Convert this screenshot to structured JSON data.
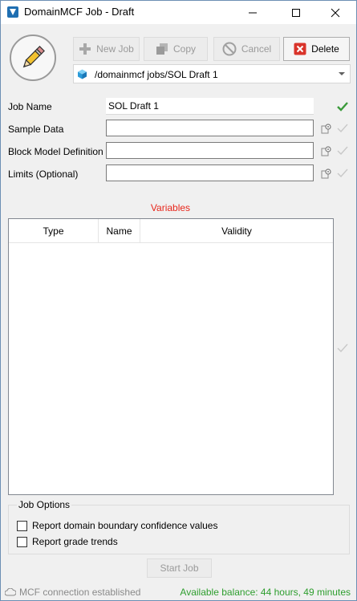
{
  "window": {
    "title": "DomainMCF Job - Draft"
  },
  "toolbar": {
    "new_job_label": "New Job",
    "copy_label": "Copy",
    "cancel_label": "Cancel",
    "delete_label": "Delete"
  },
  "path": {
    "value": "/domainmcf jobs/SOL Draft 1"
  },
  "form": {
    "job_name_label": "Job Name",
    "job_name_value": "SOL Draft 1",
    "sample_data_label": "Sample Data",
    "sample_data_value": "",
    "block_model_label": "Block Model Definition",
    "block_model_value": "",
    "limits_label": "Limits (Optional)",
    "limits_value": ""
  },
  "variables": {
    "title": "Variables",
    "columns": [
      "Type",
      "Name",
      "Validity"
    ],
    "rows": []
  },
  "job_options": {
    "title": "Job Options",
    "options": [
      {
        "label": "Report domain boundary confidence values",
        "checked": false
      },
      {
        "label": "Report grade trends",
        "checked": false
      }
    ]
  },
  "actions": {
    "start_job_label": "Start Job"
  },
  "status": {
    "connection_text": "MCF connection established",
    "balance_text": "Available balance: 44 hours, 49 minutes"
  },
  "colors": {
    "variables_title": "#e8261b",
    "balance_text": "#2e9e2e",
    "valid_check": "#3a9a3a",
    "delete_icon": "#d9342b"
  },
  "icons": {
    "app": "app-logo-icon",
    "job": "pencil-icon",
    "new_job": "plus-icon",
    "copy": "copy-icon",
    "cancel": "cancel-icon",
    "delete": "delete-x-icon",
    "path": "cube-icon",
    "connection": "cloud-icon"
  }
}
